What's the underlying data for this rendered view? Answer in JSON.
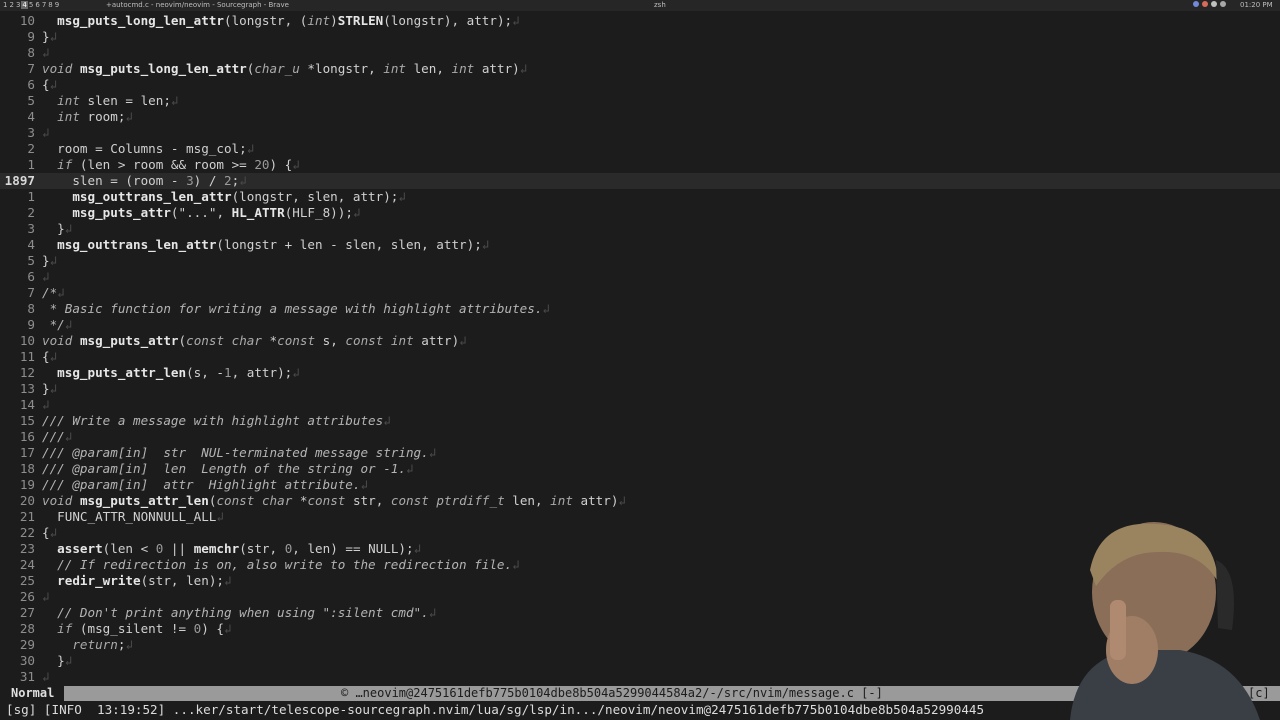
{
  "taskbar": {
    "workspaces": [
      "1",
      "2",
      "3",
      "4",
      "5",
      "6",
      "7",
      "8",
      "9"
    ],
    "active_workspace": "4",
    "window_title": "+autocmd.c - neovim/neovim - Sourcegraph - Brave",
    "terminal_label": "zsh",
    "clock": "01:20 PM"
  },
  "editor": {
    "current_line_number": "1897",
    "lines": [
      {
        "n": "10",
        "t": "  msg_puts_long_len_attr(longstr, (int)STRLEN(longstr), attr);"
      },
      {
        "n": "9",
        "t": "}"
      },
      {
        "n": "8",
        "t": ""
      },
      {
        "n": "7",
        "t": "void msg_puts_long_len_attr(char_u *longstr, int len, int attr)"
      },
      {
        "n": "6",
        "t": "{"
      },
      {
        "n": "5",
        "t": "  int slen = len;"
      },
      {
        "n": "4",
        "t": "  int room;"
      },
      {
        "n": "3",
        "t": ""
      },
      {
        "n": "2",
        "t": "  room = Columns - msg_col;"
      },
      {
        "n": "1",
        "t": "  if (len > room && room >= 20) {"
      },
      {
        "n": "1897",
        "t": "    slen = (room - 3) / 2;",
        "current": true
      },
      {
        "n": "1",
        "t": "    msg_outtrans_len_attr(longstr, slen, attr);"
      },
      {
        "n": "2",
        "t": "    msg_puts_attr(\"...\", HL_ATTR(HLF_8));"
      },
      {
        "n": "3",
        "t": "  }"
      },
      {
        "n": "4",
        "t": "  msg_outtrans_len_attr(longstr + len - slen, slen, attr);"
      },
      {
        "n": "5",
        "t": "}"
      },
      {
        "n": "6",
        "t": ""
      },
      {
        "n": "7",
        "t": "/*"
      },
      {
        "n": "8",
        "t": " * Basic function for writing a message with highlight attributes."
      },
      {
        "n": "9",
        "t": " */"
      },
      {
        "n": "10",
        "t": "void msg_puts_attr(const char *const s, const int attr)"
      },
      {
        "n": "11",
        "t": "{"
      },
      {
        "n": "12",
        "t": "  msg_puts_attr_len(s, -1, attr);"
      },
      {
        "n": "13",
        "t": "}"
      },
      {
        "n": "14",
        "t": ""
      },
      {
        "n": "15",
        "t": "/// Write a message with highlight attributes"
      },
      {
        "n": "16",
        "t": "///"
      },
      {
        "n": "17",
        "t": "/// @param[in]  str  NUL-terminated message string."
      },
      {
        "n": "18",
        "t": "/// @param[in]  len  Length of the string or -1."
      },
      {
        "n": "19",
        "t": "/// @param[in]  attr  Highlight attribute."
      },
      {
        "n": "20",
        "t": "void msg_puts_attr_len(const char *const str, const ptrdiff_t len, int attr)"
      },
      {
        "n": "21",
        "t": "  FUNC_ATTR_NONNULL_ALL"
      },
      {
        "n": "22",
        "t": "{"
      },
      {
        "n": "23",
        "t": "  assert(len < 0 || memchr(str, 0, len) == NULL);"
      },
      {
        "n": "24",
        "t": "  // If redirection is on, also write to the redirection file."
      },
      {
        "n": "25",
        "t": "  redir_write(str, len);"
      },
      {
        "n": "26",
        "t": ""
      },
      {
        "n": "27",
        "t": "  // Don't print anything when using \":silent cmd\"."
      },
      {
        "n": "28",
        "t": "  if (msg_silent != 0) {"
      },
      {
        "n": "29",
        "t": "    return;"
      },
      {
        "n": "30",
        "t": "  }"
      },
      {
        "n": "31",
        "t": ""
      }
    ]
  },
  "statusline": {
    "mode": "Normal",
    "file": "© …neovim@2475161defb775b0104dbe8b504a5299044584a2/-/src/nvim/message.c [-]",
    "right": "[c]"
  },
  "cmdline": {
    "text": "[sg] [INFO  13:19:52] ...ker/start/telescope-sourcegraph.nvim/lua/sg/lsp/in.../neovim/neovim@2475161defb775b0104dbe8b504a52990445"
  },
  "colors": {
    "background": "#1c1c1c",
    "statusline": "#9a9a9a",
    "current_line": "#2a2a2a",
    "line_number": "#8e8e8e"
  },
  "icons": [
    "brave-icon",
    "discord-icon",
    "network-icon",
    "volume-icon"
  ]
}
